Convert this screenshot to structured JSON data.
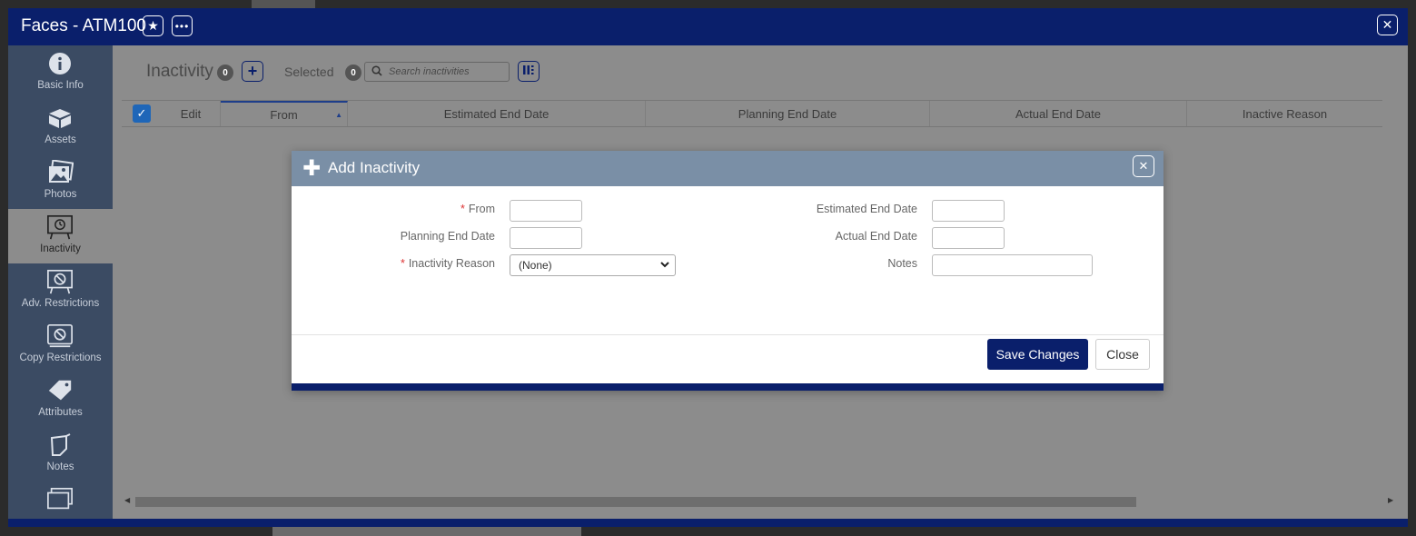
{
  "window": {
    "title": "Faces - ATM100",
    "star_icon": "star-icon",
    "more_icon": "more-icon",
    "close_glyph": "✕"
  },
  "sidebar": {
    "items": [
      {
        "label": "Basic Info",
        "icon": "info-icon"
      },
      {
        "label": "Assets",
        "icon": "box-icon"
      },
      {
        "label": "Photos",
        "icon": "photos-icon"
      },
      {
        "label": "Inactivity",
        "icon": "timer-board-icon",
        "active": true
      },
      {
        "label": "Adv. Restrictions",
        "icon": "restriction-board-icon"
      },
      {
        "label": "Copy Restrictions",
        "icon": "copy-restriction-icon"
      },
      {
        "label": "Attributes",
        "icon": "tag-icon"
      },
      {
        "label": "Notes",
        "icon": "note-icon"
      },
      {
        "label": "",
        "icon": "stack-icon"
      }
    ]
  },
  "toolbar": {
    "title": "Inactivity",
    "count": "0",
    "selected_label": "Selected",
    "selected_count": "0",
    "search_placeholder": "Search inactivities"
  },
  "grid": {
    "columns": [
      "Edit",
      "From",
      "Estimated End Date",
      "Planning End Date",
      "Actual End Date",
      "Inactive Reason"
    ],
    "sort_indicator": "▲"
  },
  "modal": {
    "title": "Add Inactivity",
    "fields": {
      "from_label": "From",
      "estimated_end_label": "Estimated End Date",
      "planning_end_label": "Planning End Date",
      "actual_end_label": "Actual End Date",
      "reason_label": "Inactivity Reason",
      "reason_value": "(None)",
      "notes_label": "Notes"
    },
    "save_label": "Save Changes",
    "close_label": "Close"
  },
  "colors": {
    "brand_navy": "#0a1f6b",
    "sidebar_bg": "#3b4b63",
    "modal_header": "#7a8fa6",
    "required_star": "#d33333",
    "checkbox_blue": "#1e66b8"
  }
}
